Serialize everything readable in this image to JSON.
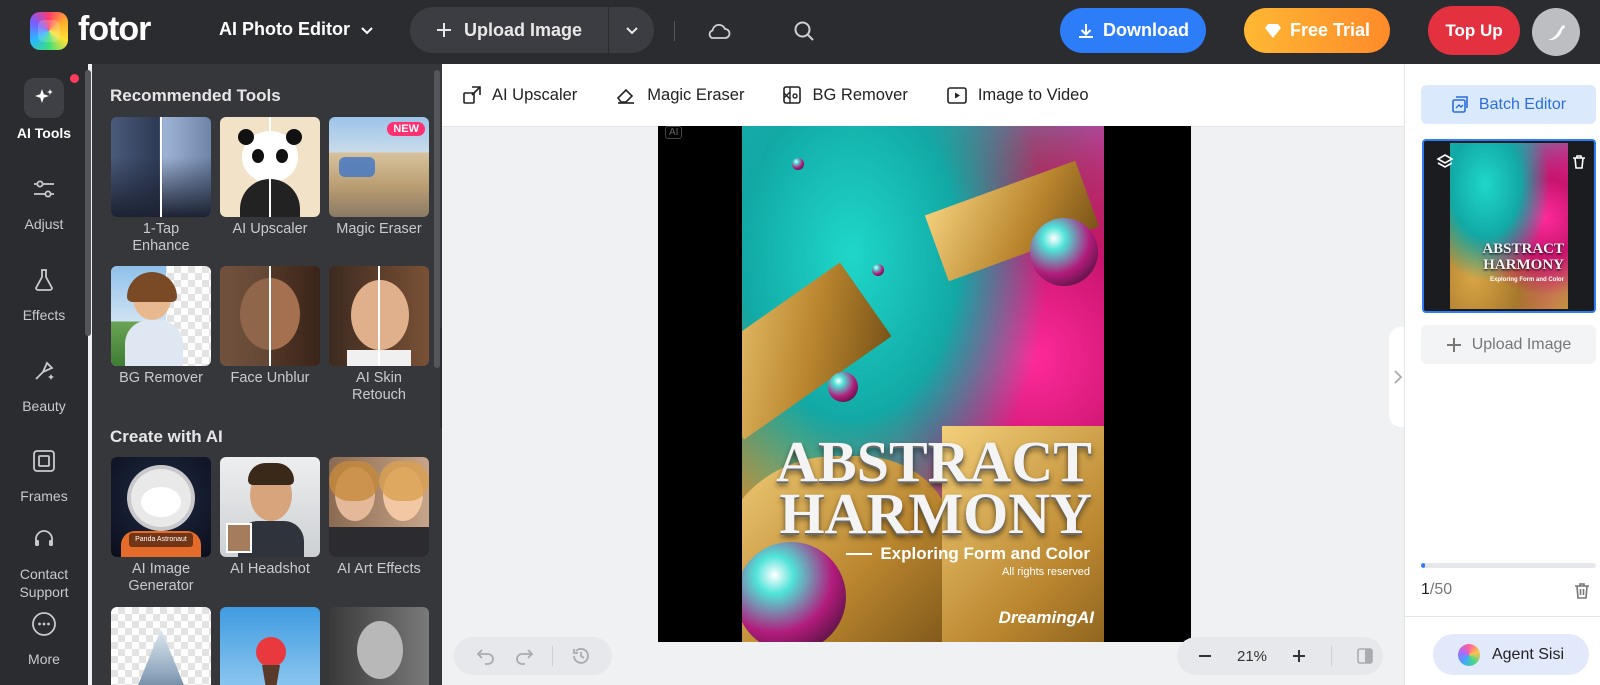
{
  "brand": {
    "name": "fotor"
  },
  "header": {
    "editor_menu": "AI Photo Editor",
    "upload": "Upload Image",
    "download": "Download",
    "free_trial": "Free Trial",
    "top_up": "Top Up"
  },
  "rail": {
    "items": [
      {
        "label": "AI Tools",
        "icon": "sparkle-icon",
        "active": true
      },
      {
        "label": "Adjust",
        "icon": "sliders-icon"
      },
      {
        "label": "Effects",
        "icon": "flask-icon"
      },
      {
        "label": "Beauty",
        "icon": "beauty-icon"
      },
      {
        "label": "Frames",
        "icon": "frame-icon"
      },
      {
        "label": "Contact Support",
        "icon": "headset-icon"
      },
      {
        "label": "More",
        "icon": "more-icon"
      }
    ]
  },
  "panel": {
    "recommended_title": "Recommended Tools",
    "recommended": [
      {
        "label": "1-Tap Enhance"
      },
      {
        "label": "AI Upscaler"
      },
      {
        "label": "Magic Eraser",
        "badge": "NEW"
      },
      {
        "label": "BG Remover"
      },
      {
        "label": "Face Unblur"
      },
      {
        "label": "AI Skin Retouch"
      }
    ],
    "create_title": "Create with AI",
    "create": [
      {
        "label": "AI Image Generator",
        "caption": "Panda Astronaut"
      },
      {
        "label": "AI Headshot"
      },
      {
        "label": "AI Art Effects"
      }
    ]
  },
  "toolstrip": {
    "items": [
      {
        "label": "AI Upscaler",
        "icon": "upscale-icon"
      },
      {
        "label": "Magic Eraser",
        "icon": "eraser-icon"
      },
      {
        "label": "BG Remover",
        "icon": "bg-remove-icon"
      },
      {
        "label": "Image to Video",
        "icon": "video-icon"
      }
    ]
  },
  "canvas": {
    "ai_tag": "AI",
    "poster": {
      "title_line1": "ABSTRACT",
      "title_line2": "HARMONY",
      "subtitle": "Exploring Form and Color",
      "rights": "All rights reserved",
      "brand": "DreamingAI"
    },
    "zoom": "21%"
  },
  "right_panel": {
    "batch_editor": "Batch Editor",
    "upload": "Upload Image",
    "count_current": "1",
    "count_total": "/50",
    "progress": 0.02,
    "agent": "Agent Sisi"
  },
  "colors": {
    "accent": "#2c7df7",
    "trial_start": "#ffb833",
    "trial_end": "#ff8a2a",
    "top_up": "#e3313f",
    "dark_bg": "#2b2c30"
  }
}
